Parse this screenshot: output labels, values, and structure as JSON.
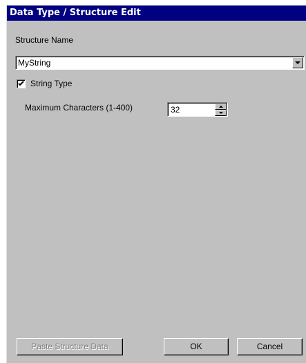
{
  "window": {
    "title": "Data Type / Structure Edit"
  },
  "form": {
    "structure_name_label": "Structure Name",
    "structure_name_value": "MyString",
    "string_type_label": "String Type",
    "string_type_checked": true,
    "max_chars_label": "Maximum Characters (1-400)",
    "max_chars_value": "32"
  },
  "footer": {
    "paste_label": "Paste Structure Data",
    "ok_label": "OK",
    "cancel_label": "Cancel"
  },
  "icons": [
    "chevron-down-icon",
    "checkmark-icon",
    "spin-up-icon",
    "spin-down-icon"
  ]
}
